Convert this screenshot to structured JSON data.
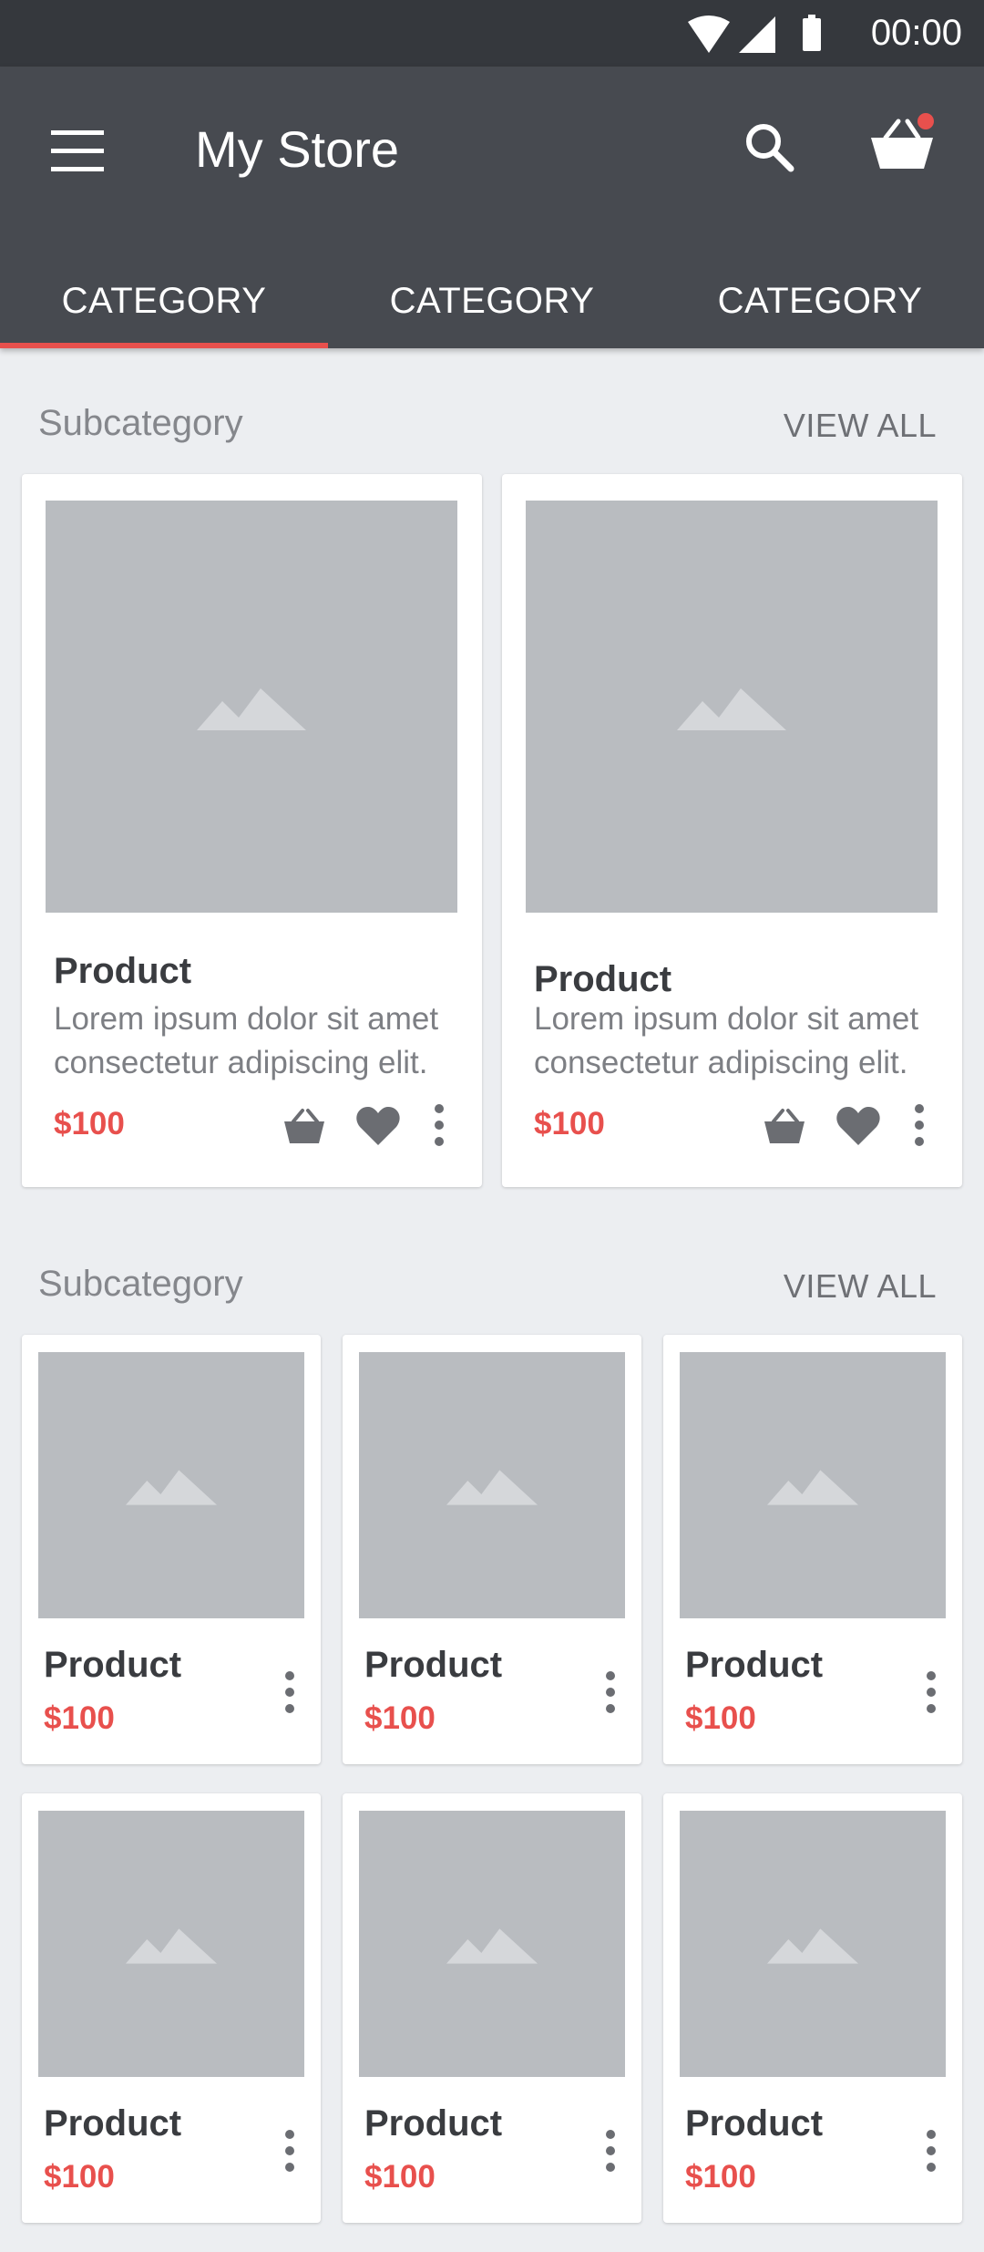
{
  "status_bar": {
    "time": "00:00",
    "icons": [
      "wifi-icon",
      "signal-icon",
      "battery-icon"
    ]
  },
  "app_bar": {
    "title": "My Store",
    "cart_badge_color": "#e8504d"
  },
  "tabs": [
    {
      "label": "CATEGORY",
      "active": true
    },
    {
      "label": "CATEGORY",
      "active": false
    },
    {
      "label": "CATEGORY",
      "active": false
    }
  ],
  "sections": [
    {
      "title": "Subcategory",
      "view_all": "VIEW ALL",
      "products": [
        {
          "name": "Product",
          "description": "Lorem ipsum dolor sit amet consectetur adipiscing elit.",
          "price": "$100"
        },
        {
          "name": "Product",
          "description": "Lorem ipsum dolor sit amet consectetur adipiscing elit.",
          "price": "$100"
        }
      ]
    },
    {
      "title": "Subcategory",
      "view_all": "VIEW ALL",
      "products": [
        {
          "name": "Product",
          "price": "$100"
        },
        {
          "name": "Product",
          "price": "$100"
        },
        {
          "name": "Product",
          "price": "$100"
        },
        {
          "name": "Product",
          "price": "$100"
        },
        {
          "name": "Product",
          "price": "$100"
        },
        {
          "name": "Product",
          "price": "$100"
        }
      ]
    }
  ],
  "colors": {
    "accent": "#e8504d",
    "app_bar": "#474a50",
    "status_bar": "#35383d",
    "background": "#eceef1",
    "placeholder": "#b9bcc0"
  }
}
